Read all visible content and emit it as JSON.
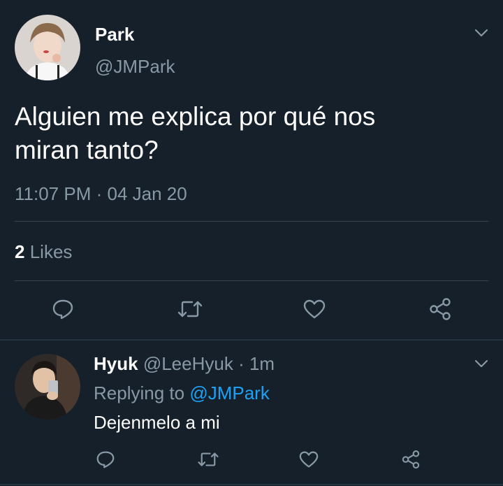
{
  "main_tweet": {
    "display_name": "Park",
    "handle": "@JMPark",
    "text_line1": "Alguien me explica por qué nos",
    "text_line2": "miran tanto?",
    "time": "11:07 PM",
    "separator": "·",
    "date": "04 Jan 20",
    "likes_count": "2",
    "likes_label": "Likes",
    "actions": [
      "reply-icon",
      "retweet-icon",
      "like-icon",
      "share-icon"
    ]
  },
  "reply": {
    "display_name": "Hyuk",
    "handle": "@LeeHyuk",
    "time_ago": "· 1m",
    "replying_to_label": "Replying to",
    "replying_to_handle": "@JMPark",
    "text": "Dejenmelo a mi",
    "actions": [
      "reply-icon",
      "retweet-icon",
      "like-icon",
      "share-icon"
    ]
  },
  "colors": {
    "background": "#15202b",
    "muted": "#8899a6",
    "accent": "#1da1f2",
    "divider": "#38444d"
  }
}
